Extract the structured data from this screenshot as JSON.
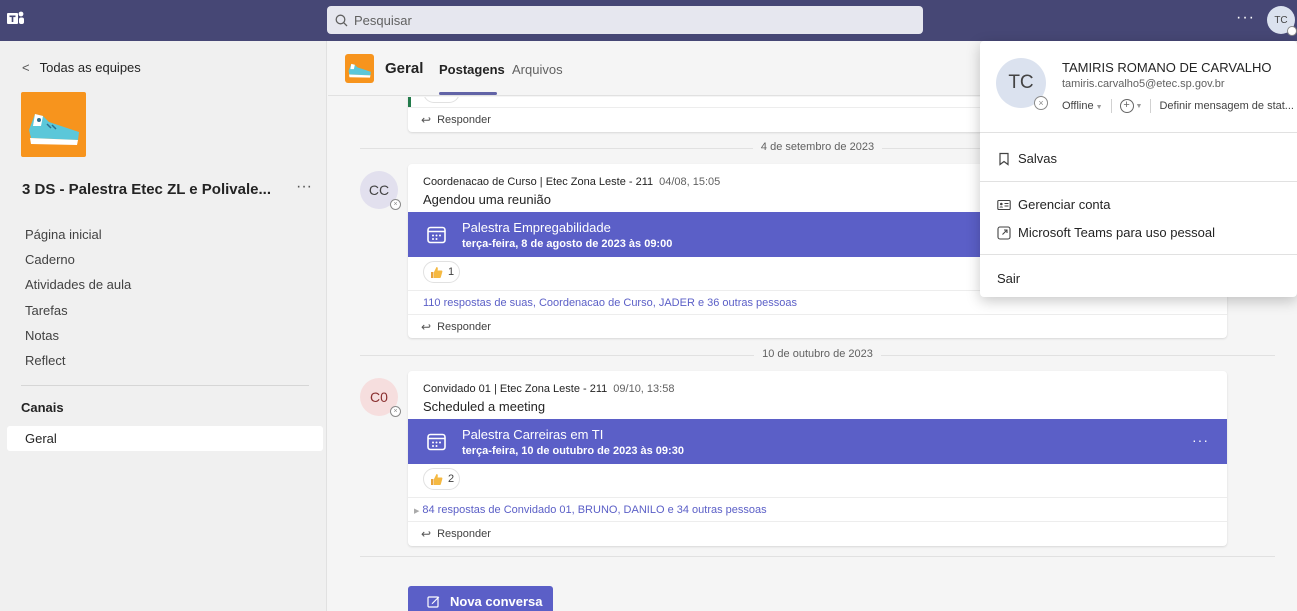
{
  "topbar": {
    "search_placeholder": "Pesquisar",
    "avatar_initials": "TC"
  },
  "sidebar": {
    "back_label": "Todas as equipes",
    "team_name": "3 DS - Palestra Etec ZL e Polivale...",
    "nav": [
      "Página inicial",
      "Caderno",
      "Atividades de aula",
      "Tarefas",
      "Notas",
      "Reflect"
    ],
    "channels_heading": "Canais",
    "channels": [
      "Geral"
    ]
  },
  "header": {
    "channel_title": "Geral",
    "tabs": [
      "Postagens",
      "Arquivos"
    ]
  },
  "feed": {
    "reply_label": "Responder",
    "posts": [
      {
        "date_separator": "4 de setembro de 2023",
        "avatar": "CC",
        "author": "Coordenacao de Curso | Etec Zona Leste - 211",
        "time": "04/08, 15:05",
        "subject": "Agendou uma reunião",
        "meeting_title": "Palestra Empregabilidade",
        "meeting_date": "terça-feira, 8 de agosto de 2023 às 09:00",
        "reaction_count": "1",
        "replies_summary": "110 respostas de suas, Coordenacao de Curso, JADER e 36 outras pessoas"
      },
      {
        "date_separator": "10 de outubro de 2023",
        "avatar": "C0",
        "author": "Convidado 01 | Etec Zona Leste - 211",
        "time": "09/10, 13:58",
        "subject": "Scheduled a meeting",
        "meeting_title": "Palestra Carreiras em TI",
        "meeting_date": "terça-feira, 10 de outubro de 2023 às 09:30",
        "reaction_count": "2",
        "replies_summary": "84 respostas de Convidado 01, BRUNO, DANILO e 34 outras pessoas"
      }
    ],
    "new_conversation_label": "Nova conversa"
  },
  "profile_menu": {
    "initials": "TC",
    "name": "TAMIRIS ROMANO DE CARVALHO",
    "email": "tamiris.carvalho5@etec.sp.gov.br",
    "status": "Offline",
    "status_message": "Definir mensagem de stat...",
    "items": [
      "Salvas",
      "Gerenciar conta",
      "Microsoft Teams para uso pessoal",
      "Sair"
    ]
  },
  "colors": {
    "topbar": "#464775",
    "accent": "#5b5fc7",
    "team_orange": "#f7941d"
  }
}
